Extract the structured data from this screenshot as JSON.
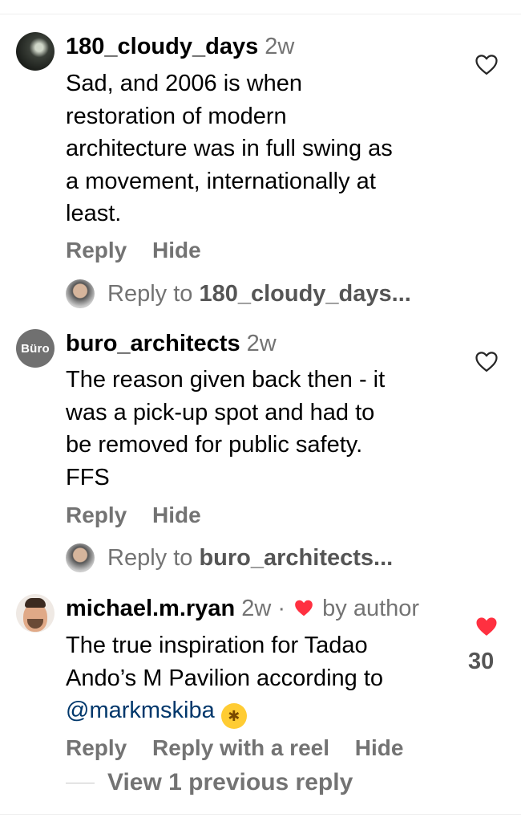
{
  "comments": [
    {
      "username": "180_cloudy_days",
      "time": "2w",
      "text_lines": [
        "Sad, and 2006 is when",
        "restoration of modern",
        "architecture was in full swing as",
        "a movement, internationally at",
        "least."
      ],
      "actions": [
        "Reply",
        "Hide"
      ],
      "reply_prompt_prefix": "Reply to ",
      "reply_prompt_target": "180_cloudy_days...",
      "liked": false
    },
    {
      "username": "buro_architects",
      "avatar_text": "Büro",
      "time": "2w",
      "text_lines": [
        "The reason given back then - it",
        "was a pick-up spot and had to",
        "be removed for public safety.",
        "FFS"
      ],
      "actions": [
        "Reply",
        "Hide"
      ],
      "reply_prompt_prefix": "Reply to ",
      "reply_prompt_target": "buro_architects...",
      "liked": false
    },
    {
      "username": "michael.m.ryan",
      "time": "2w",
      "separator": "·",
      "badge": "by author",
      "text_lines": [
        "The true inspiration for Tadao",
        "Ando’s M Pavilion according to"
      ],
      "mention": "@markmskiba",
      "emoji": "rolling-on-floor-laughing",
      "actions": [
        "Reply",
        "Reply with a reel",
        "Hide"
      ],
      "likes": "30",
      "liked": true
    }
  ],
  "view_previous": "View 1 previous reply",
  "colors": {
    "heart_red": "#ff3040",
    "secondary_text": "#737373",
    "link": "#00376b"
  }
}
